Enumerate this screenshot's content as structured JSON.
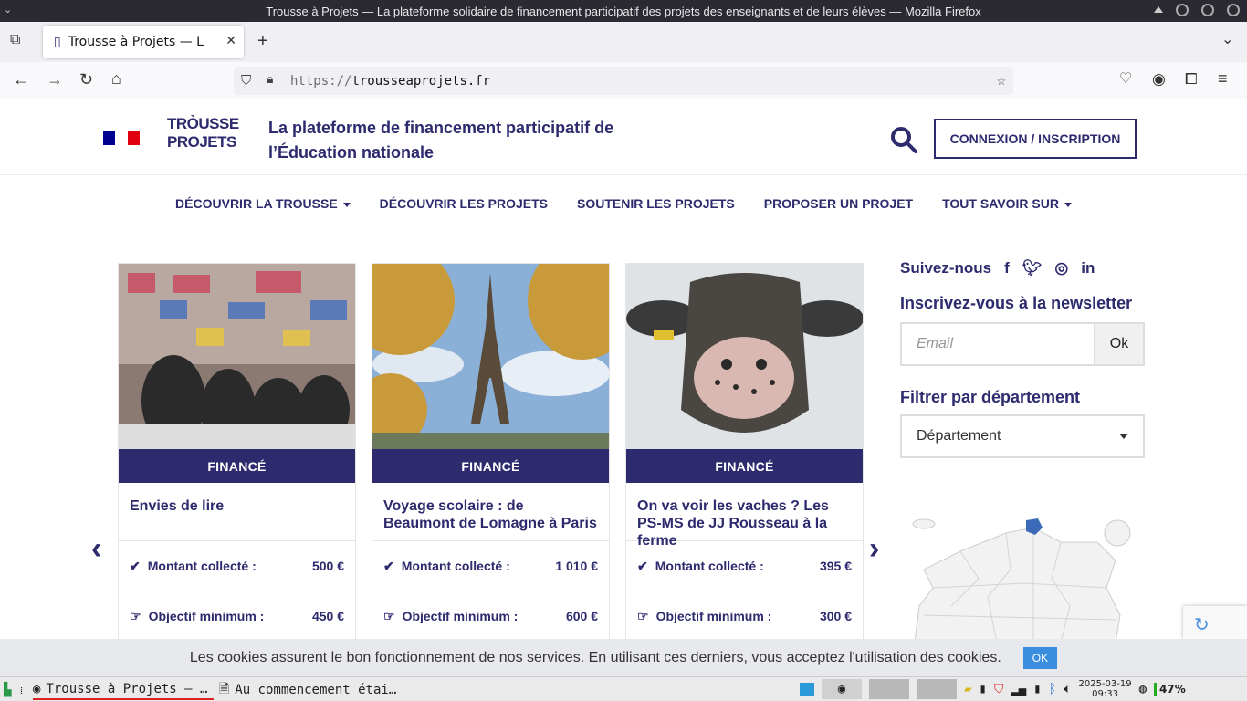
{
  "window": {
    "title": "Trousse à Projets — La plateforme solidaire de financement participatif des projets des enseignants et de leurs élèves — Mozilla Firefox"
  },
  "browser": {
    "tab_title": "Trousse à Projets — L",
    "url_scheme": "https://",
    "url_host": "trousseaprojets.fr"
  },
  "site": {
    "logo_line1": "TRÒUSSE",
    "logo_line2": "PROJETS",
    "tagline": "La plateforme de financement participatif de l’Éducation nationale",
    "login_label": "CONNEXION / INSCRIPTION",
    "nav": [
      {
        "label": "DÉCOUVRIR LA TROUSSE",
        "dropdown": true
      },
      {
        "label": "DÉCOUVRIR LES PROJETS",
        "dropdown": false
      },
      {
        "label": "SOUTENIR LES PROJETS",
        "dropdown": false
      },
      {
        "label": "PROPOSER UN PROJET",
        "dropdown": false
      },
      {
        "label": "TOUT SAVOIR SUR",
        "dropdown": true
      }
    ],
    "flag_colors": [
      "#000091",
      "#ffffff",
      "#e1000f"
    ],
    "brand_color": "#2d2a6e"
  },
  "cards": [
    {
      "status": "FINANCÉ",
      "title": "Envies de lire",
      "collected_label": "Montant collecté :",
      "collected_value": "500 €",
      "goal_label": "Objectif minimum :",
      "goal_value": "450 €"
    },
    {
      "status": "FINANCÉ",
      "title": "Voyage scolaire : de Beaumont de Lomagne à Paris",
      "collected_label": "Montant collecté :",
      "collected_value": "1 010 €",
      "goal_label": "Objectif minimum :",
      "goal_value": "600 €"
    },
    {
      "status": "FINANCÉ",
      "title": "On va voir les vaches ? Les PS-MS de JJ Rousseau à la ferme",
      "collected_label": "Montant collecté :",
      "collected_value": "395 €",
      "goal_label": "Objectif minimum :",
      "goal_value": "300 €"
    }
  ],
  "sidebar": {
    "follow_label": "Suivez-nous",
    "newsletter_title": "Inscrivez-vous à la newsletter",
    "email_placeholder": "Email",
    "ok_label": "Ok",
    "filter_title": "Filtrer par département",
    "dept_selected": "Département"
  },
  "cookie": {
    "text": "Les cookies assurent le bon fonctionnement de nos services. En utilisant ces derniers, vous acceptez l'utilisation des cookies.",
    "ok_label": "OK"
  },
  "taskbar": {
    "task1": "Trousse à Projets — …",
    "task2": "Au commencement étai…",
    "date": "2025-03-19",
    "time": "09:33",
    "battery": "47%"
  }
}
